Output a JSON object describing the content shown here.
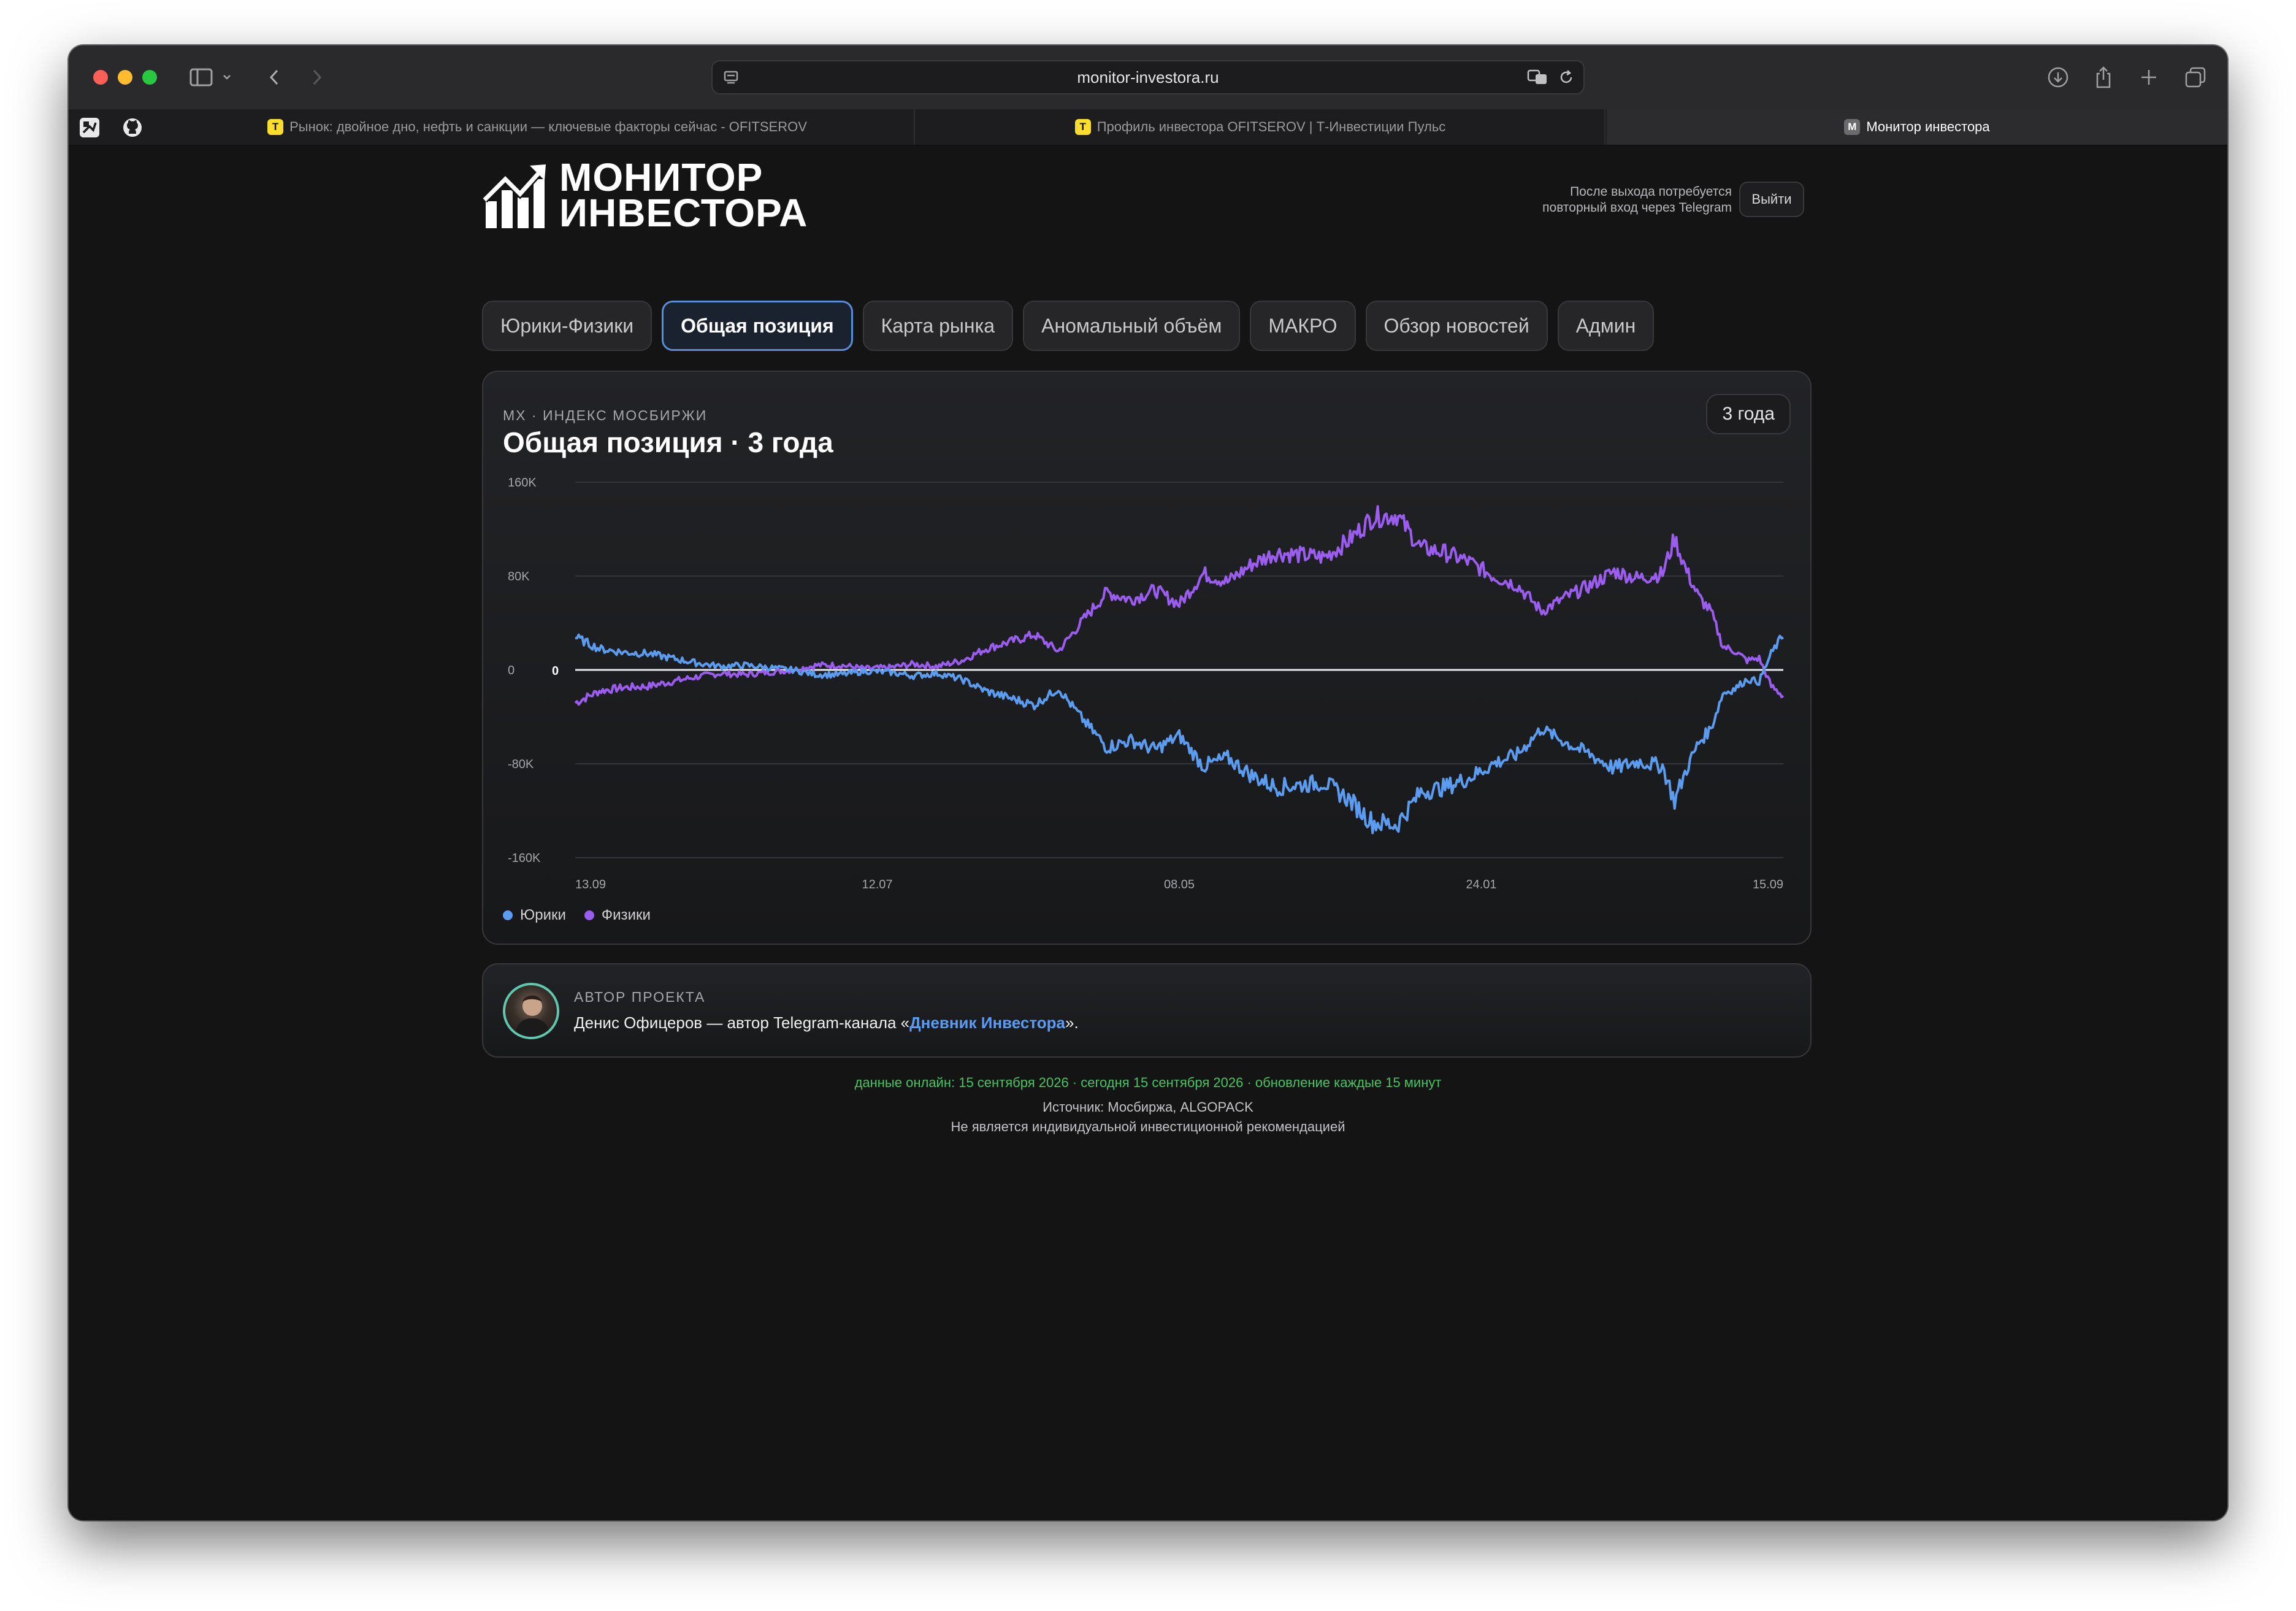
{
  "browser": {
    "url": "monitor-investora.ru",
    "tabs": [
      {
        "title": "Рынок: двойное дно, нефть и санкции — ключевые факторы сейчас - OFITSEROV",
        "favicon": "T",
        "active": false
      },
      {
        "title": "Профиль инвестора OFITSEROV | Т-Инвестиции Пульс",
        "favicon": "T",
        "active": false
      },
      {
        "title": "Монитор инвестора",
        "favicon": "M",
        "active": true
      }
    ]
  },
  "header": {
    "logo_line1": "МОНИТОР",
    "logo_line2": "ИНВЕСТОРА",
    "logout_note_line1": "После выхода потребуется",
    "logout_note_line2": "повторный вход через Telegram",
    "logout_label": "Выйти"
  },
  "nav": {
    "items": [
      {
        "label": "Юрики-Физики",
        "active": false
      },
      {
        "label": "Общая позиция",
        "active": true
      },
      {
        "label": "Карта рынка",
        "active": false
      },
      {
        "label": "Аномальный объём",
        "active": false
      },
      {
        "label": "МАКРО",
        "active": false
      },
      {
        "label": "Обзор новостей",
        "active": false
      },
      {
        "label": "Админ",
        "active": false
      }
    ]
  },
  "chart_card": {
    "kicker": "MX · ИНДЕКС МОСБИРЖИ",
    "title": "Общая позиция · 3 года",
    "period_label": "3 года"
  },
  "chart_data": {
    "type": "line",
    "title": "Общая позиция · 3 года",
    "ylim": [
      -160000,
      160000
    ],
    "y_ticks": [
      "160K",
      "80K",
      "0",
      "-80K",
      "-160K"
    ],
    "zero_label": "0",
    "x_tick_labels": [
      "13.09",
      "12.07",
      "08.05",
      "24.01",
      "15.09"
    ],
    "grid": true,
    "legend_position": "bottom-left",
    "colors": {
      "yuriki": "#5b9cf0",
      "fiziki": "#9b5cf0"
    },
    "series": [
      {
        "name": "Физики",
        "x_fraction": [
          0,
          0.02,
          0.04,
          0.06,
          0.08,
          0.1,
          0.12,
          0.14,
          0.16,
          0.18,
          0.2,
          0.22,
          0.24,
          0.26,
          0.28,
          0.3,
          0.32,
          0.34,
          0.36,
          0.38,
          0.4,
          0.42,
          0.44,
          0.46,
          0.48,
          0.5,
          0.52,
          0.54,
          0.56,
          0.58,
          0.6,
          0.62,
          0.64,
          0.66,
          0.68,
          0.7,
          0.72,
          0.74,
          0.76,
          0.78,
          0.8,
          0.82,
          0.84,
          0.86,
          0.88,
          0.9,
          0.91,
          0.92,
          0.93,
          0.94,
          0.95,
          0.96,
          0.97,
          0.98,
          0.99,
          1.0
        ],
        "values": [
          -28000,
          -18000,
          -15000,
          -14000,
          -10000,
          -6000,
          -3000,
          -4000,
          -2000,
          0,
          4000,
          4000,
          1000,
          2000,
          5000,
          3000,
          8000,
          18000,
          24000,
          30000,
          16000,
          42000,
          66000,
          60000,
          68000,
          56000,
          82000,
          75000,
          90000,
          100000,
          98000,
          96000,
          110000,
          130000,
          132000,
          104000,
          100000,
          92000,
          80000,
          72000,
          50000,
          62000,
          72000,
          84000,
          78000,
          82000,
          112000,
          84000,
          62000,
          50000,
          20000,
          16000,
          8000,
          10000,
          -14000,
          -22000
        ]
      },
      {
        "name": "Юрики",
        "x_fraction": [
          0,
          0.02,
          0.04,
          0.06,
          0.08,
          0.1,
          0.12,
          0.14,
          0.16,
          0.18,
          0.2,
          0.22,
          0.24,
          0.26,
          0.28,
          0.3,
          0.32,
          0.34,
          0.36,
          0.38,
          0.4,
          0.42,
          0.44,
          0.46,
          0.48,
          0.5,
          0.52,
          0.54,
          0.56,
          0.58,
          0.6,
          0.62,
          0.64,
          0.66,
          0.68,
          0.7,
          0.72,
          0.74,
          0.76,
          0.78,
          0.8,
          0.82,
          0.84,
          0.86,
          0.88,
          0.9,
          0.91,
          0.92,
          0.93,
          0.94,
          0.95,
          0.96,
          0.97,
          0.98,
          0.99,
          1.0
        ],
        "values": [
          28000,
          18000,
          15000,
          14000,
          10000,
          6000,
          3000,
          4000,
          2000,
          0,
          -4000,
          -4000,
          -1000,
          -2000,
          -5000,
          -3000,
          -8000,
          -18000,
          -24000,
          -30000,
          -16000,
          -42000,
          -66000,
          -60000,
          -68000,
          -56000,
          -82000,
          -75000,
          -90000,
          -100000,
          -98000,
          -96000,
          -110000,
          -130000,
          -132000,
          -104000,
          -100000,
          -92000,
          -80000,
          -72000,
          -50000,
          -62000,
          -72000,
          -84000,
          -78000,
          -82000,
          -112000,
          -84000,
          -62000,
          -50000,
          -20000,
          -16000,
          -8000,
          -10000,
          14000,
          30000
        ]
      }
    ]
  },
  "legend": {
    "yuriki": "Юрики",
    "fiziki": "Физики"
  },
  "author": {
    "kicker": "АВТОР ПРОЕКТА",
    "text_before": "Денис Офицеров — автор Telegram-канала «",
    "link_text": "Дневник Инвестора",
    "text_after": "»."
  },
  "footer": {
    "status": "данные онлайн: 15 сентября 2026 · сегодня 15 сентября 2026 · обновление каждые 15 минут",
    "source": "Источник: Мосбиржа, ALGOPACK",
    "disclaimer": "Не является индивидуальной инвестиционной рекомендацией"
  }
}
